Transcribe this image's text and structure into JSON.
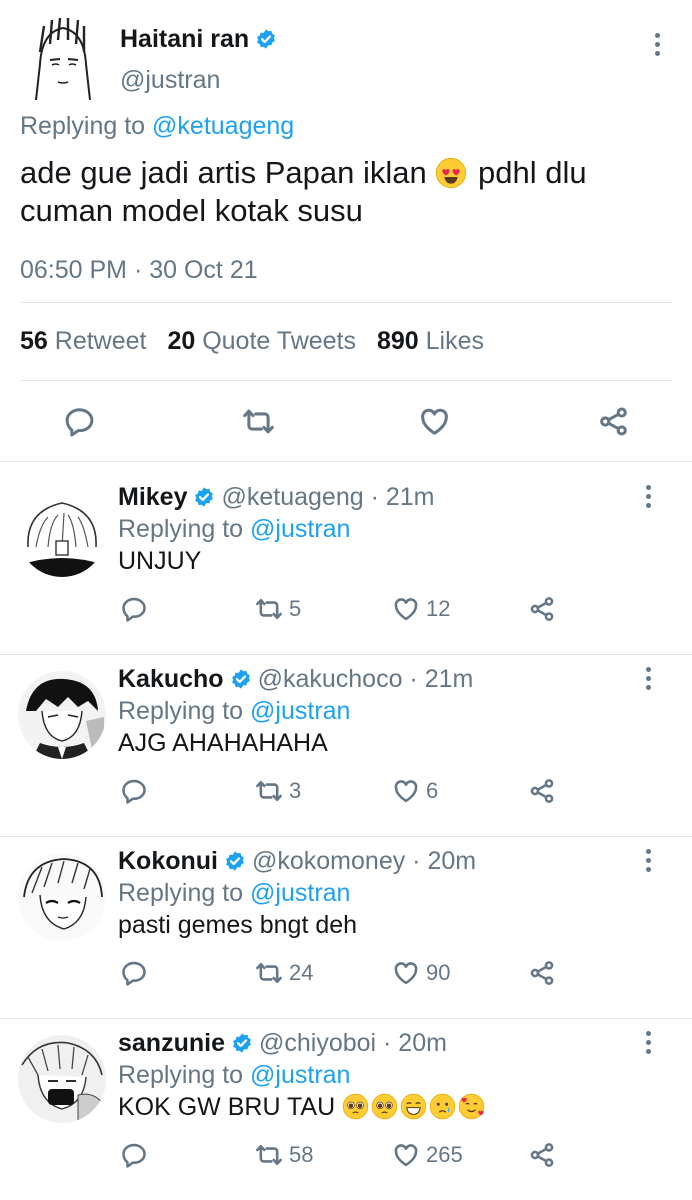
{
  "main_tweet": {
    "author_name": "Haitani ran",
    "handle": "@justran",
    "replying_prefix": "Replying to",
    "replying_handle": "@ketuageng",
    "text_part1": "ade gue jadi artis Papan iklan",
    "text_part2": "pdhl dlu cuman model kotak susu",
    "timestamp": "06:50 PM · 30 Oct 21",
    "stats": {
      "retweets_count": "56",
      "retweets_label": "Retweet",
      "quotes_count": "20",
      "quotes_label": "Quote Tweets",
      "likes_count": "890",
      "likes_label": "Likes"
    }
  },
  "replies": [
    {
      "name": "Mikey",
      "meta": "@ketuageng · 21m",
      "replying_prefix": "Replying to",
      "replying_handle": "@justran",
      "text": "UNJUY",
      "retweets": "5",
      "likes": "12"
    },
    {
      "name": "Kakucho",
      "meta": "@kakuchoco · 21m",
      "replying_prefix": "Replying to",
      "replying_handle": "@justran",
      "text": "AJG AHAHAHAHA",
      "retweets": "3",
      "likes": "6"
    },
    {
      "name": "Kokonui",
      "meta": "@kokomoney · 20m",
      "replying_prefix": "Replying to",
      "replying_handle": "@justran",
      "text": "pasti gemes bngt deh",
      "retweets": "24",
      "likes": "90"
    },
    {
      "name": "sanzunie",
      "meta": "@chiyoboi · 20m",
      "replying_prefix": "Replying to",
      "replying_handle": "@justran",
      "text": "KOK GW BRU TAU",
      "retweets": "58",
      "likes": "265"
    }
  ],
  "colors": {
    "accent": "#1da1f2",
    "secondary_text": "#657786",
    "divider": "#e1e8ed"
  }
}
